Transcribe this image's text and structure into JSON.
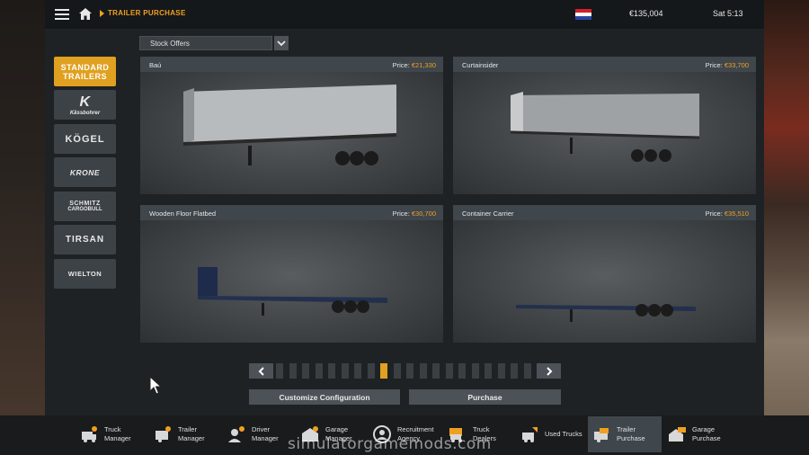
{
  "header": {
    "breadcrumb": "TRAILER PURCHASE",
    "money": "€135,004",
    "time": "Sat 5:13",
    "flag_colors": [
      "#d21f2b",
      "#ffffff",
      "#2546a0"
    ]
  },
  "filter": {
    "selected": "Stock Offers"
  },
  "brands": [
    {
      "title": "STANDARD",
      "sub": "TRAILERS",
      "active": true
    },
    {
      "title": "K",
      "sub": "Kässbohrer",
      "active": false
    },
    {
      "title": "KÖGEL",
      "sub": "",
      "active": false
    },
    {
      "title": "KRONE",
      "sub": "",
      "active": false
    },
    {
      "title": "SCHMITZ",
      "sub": "CARGOBULL",
      "active": false
    },
    {
      "title": "TIRSAN",
      "sub": "",
      "active": false
    },
    {
      "title": "WIELTON",
      "sub": "",
      "active": false
    }
  ],
  "offers": [
    {
      "name": "Baú",
      "price_label": "Price:",
      "price": "€21,330"
    },
    {
      "name": "Curtainsider",
      "price_label": "Price:",
      "price": "€33,700"
    },
    {
      "name": "Wooden Floor Flatbed",
      "price_label": "Price:",
      "price": "€30,700"
    },
    {
      "name": "Container Carrier",
      "price_label": "Price:",
      "price": "€35,510"
    }
  ],
  "pager": {
    "total_pages": 20,
    "current_page": 9
  },
  "actions": {
    "customize": "Customize Configuration",
    "purchase": "Purchase"
  },
  "nav": [
    {
      "line1": "Truck",
      "line2": "Manager",
      "icon": "truck-manager-icon"
    },
    {
      "line1": "Trailer",
      "line2": "Manager",
      "icon": "trailer-manager-icon"
    },
    {
      "line1": "Driver",
      "line2": "Manager",
      "icon": "driver-manager-icon"
    },
    {
      "line1": "Garage",
      "line2": "Manager",
      "icon": "garage-manager-icon"
    },
    {
      "line1": "Recruitment",
      "line2": "Agency",
      "icon": "recruitment-icon"
    },
    {
      "line1": "Truck",
      "line2": "Dealers",
      "icon": "truck-dealers-icon"
    },
    {
      "line1": "Used Trucks",
      "line2": "",
      "icon": "used-trucks-icon"
    },
    {
      "line1": "Trailer",
      "line2": "Purchase",
      "icon": "trailer-purchase-icon",
      "active": true
    },
    {
      "line1": "Garage",
      "line2": "Purchase",
      "icon": "garage-purchase-icon"
    }
  ],
  "watermark": "simulatorgamemods.com",
  "colors": {
    "accent": "#f0a020",
    "panel": "#1f2224",
    "tile": "#3d4247"
  }
}
